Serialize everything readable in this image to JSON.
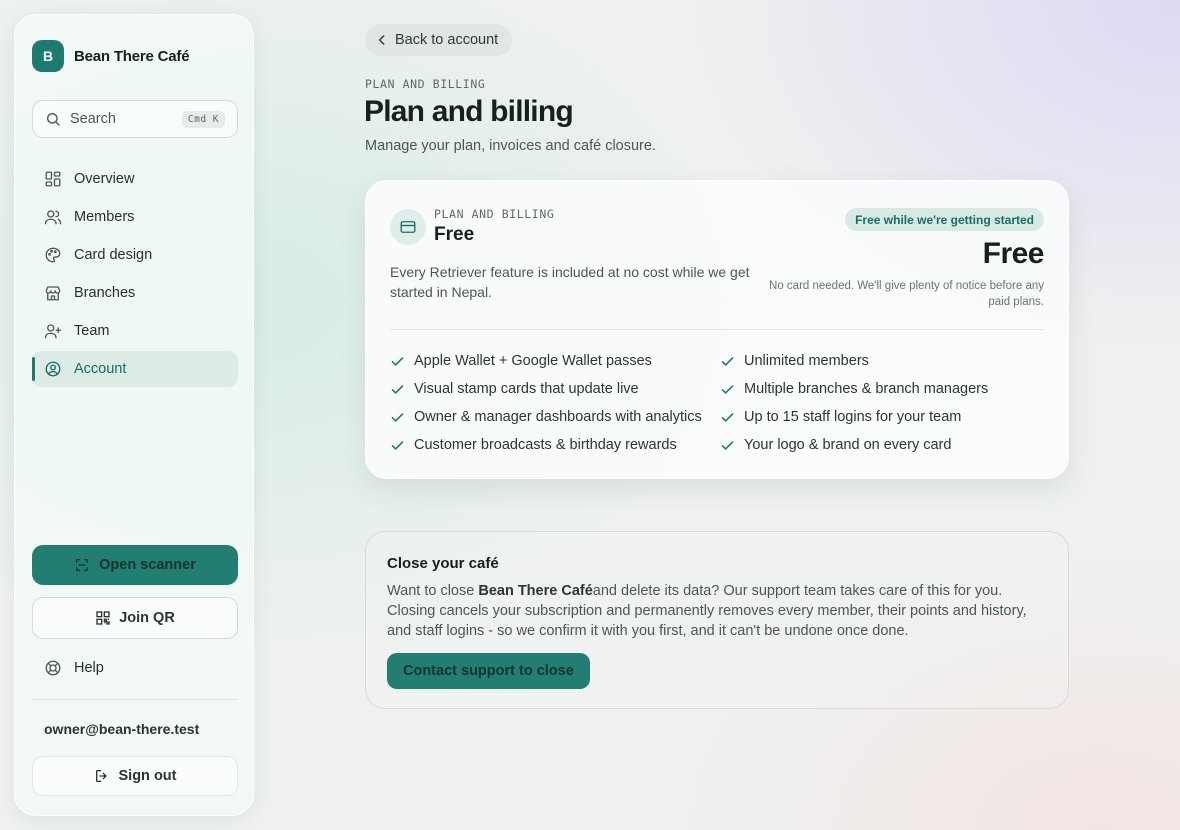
{
  "sidebar": {
    "brand_initial": "B",
    "brand_name": "Bean There Café",
    "search": {
      "label": "Search",
      "shortcut": "Cmd K"
    },
    "nav": [
      {
        "label": "Overview",
        "icon": "grid-icon",
        "active": false
      },
      {
        "label": "Members",
        "icon": "users-icon",
        "active": false
      },
      {
        "label": "Card design",
        "icon": "palette-icon",
        "active": false
      },
      {
        "label": "Branches",
        "icon": "store-icon",
        "active": false
      },
      {
        "label": "Team",
        "icon": "user-plus-icon",
        "active": false
      },
      {
        "label": "Account",
        "icon": "user-circle-icon",
        "active": true
      }
    ],
    "open_scanner": "Open scanner",
    "join_qr": "Join QR",
    "help": "Help",
    "email": "owner@bean-there.test",
    "sign_out": "Sign out"
  },
  "main": {
    "back_label": "Back to account",
    "eyebrow": "PLAN AND BILLING",
    "title": "Plan and billing",
    "subtitle": "Manage your plan, invoices and café closure."
  },
  "plan": {
    "eyebrow": "PLAN AND BILLING",
    "name": "Free",
    "description": "Every Retriever feature is included at no cost while we get started in Nepal.",
    "badge": "Free while we're getting started",
    "price": "Free",
    "note": "No card needed. We'll give plenty of notice before any paid plans.",
    "features": [
      [
        "Apple Wallet + Google Wallet passes",
        "Unlimited members"
      ],
      [
        "Visual stamp cards that update live",
        "Multiple branches & branch managers"
      ],
      [
        "Owner & manager dashboards with analytics",
        "Up to 15 staff logins for your team"
      ],
      [
        "Customer broadcasts & birthday rewards",
        "Your logo & brand on every card"
      ]
    ]
  },
  "close": {
    "title": "Close your café",
    "body_prefix": "Want to close ",
    "body_cafe": "Bean There Café",
    "body_rest": "and delete its data? Our support team takes care of this for you. Closing cancels your subscription and permanently removes every member, their points and history, and staff logins - so we confirm it with you first, and it can't be undone once done.",
    "button": "Contact support to close"
  },
  "colors": {
    "accent": "#1d7a6e",
    "accent_button": "#237e72",
    "badge_bg": "#d7ebe4"
  }
}
